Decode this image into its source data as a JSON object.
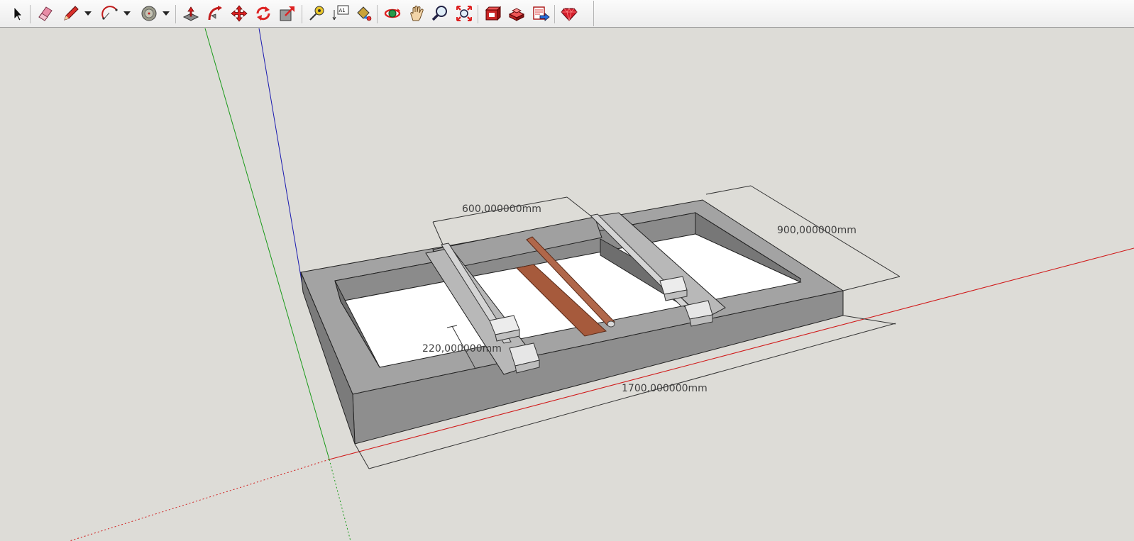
{
  "toolbar": {
    "tools": [
      {
        "id": "select",
        "icon": "select-arrow-icon"
      },
      {
        "id": "eraser",
        "icon": "eraser-icon"
      },
      {
        "id": "pencil",
        "icon": "pencil-icon"
      },
      {
        "id": "arc",
        "icon": "arc-icon"
      },
      {
        "id": "circle",
        "icon": "circle-icon"
      },
      {
        "id": "push-pull",
        "icon": "push-pull-icon"
      },
      {
        "id": "follow-me",
        "icon": "follow-me-icon"
      },
      {
        "id": "move",
        "icon": "move-icon"
      },
      {
        "id": "rotate",
        "icon": "rotate-icon"
      },
      {
        "id": "scale",
        "icon": "scale-icon"
      },
      {
        "id": "tape-measure",
        "icon": "tape-measure-icon"
      },
      {
        "id": "text",
        "icon": "text-tool-icon",
        "glyph": "A1"
      },
      {
        "id": "paint-bucket",
        "icon": "paint-bucket-icon"
      },
      {
        "id": "orbit",
        "icon": "orbit-icon"
      },
      {
        "id": "pan",
        "icon": "pan-hand-icon"
      },
      {
        "id": "zoom",
        "icon": "zoom-icon"
      },
      {
        "id": "zoom-extents",
        "icon": "zoom-extents-icon"
      },
      {
        "id": "3d-warehouse",
        "icon": "warehouse-icon"
      },
      {
        "id": "components",
        "icon": "components-icon"
      },
      {
        "id": "share-model",
        "icon": "share-model-icon"
      },
      {
        "id": "ruby",
        "icon": "ruby-icon"
      }
    ]
  },
  "scene": {
    "colors": {
      "background": "#dddcd7",
      "axis_red": "#d01818",
      "axis_green": "#1a9a1a",
      "axis_blue": "#1a1ab0",
      "concrete_top": "#a3a3a3",
      "concrete_side": "#8c8c8c",
      "concrete_inner": "#7a7a7a",
      "rod": "#b0674a",
      "wood_board": "#a65a3c",
      "rail": "#c9c9c9",
      "carriage": "#e6e6e6"
    },
    "dimensions": {
      "overall_length": "1700,000000mm",
      "overall_width": "900,000000mm",
      "rail_spacing": "600,000000mm",
      "height": "220,000000mm"
    }
  }
}
